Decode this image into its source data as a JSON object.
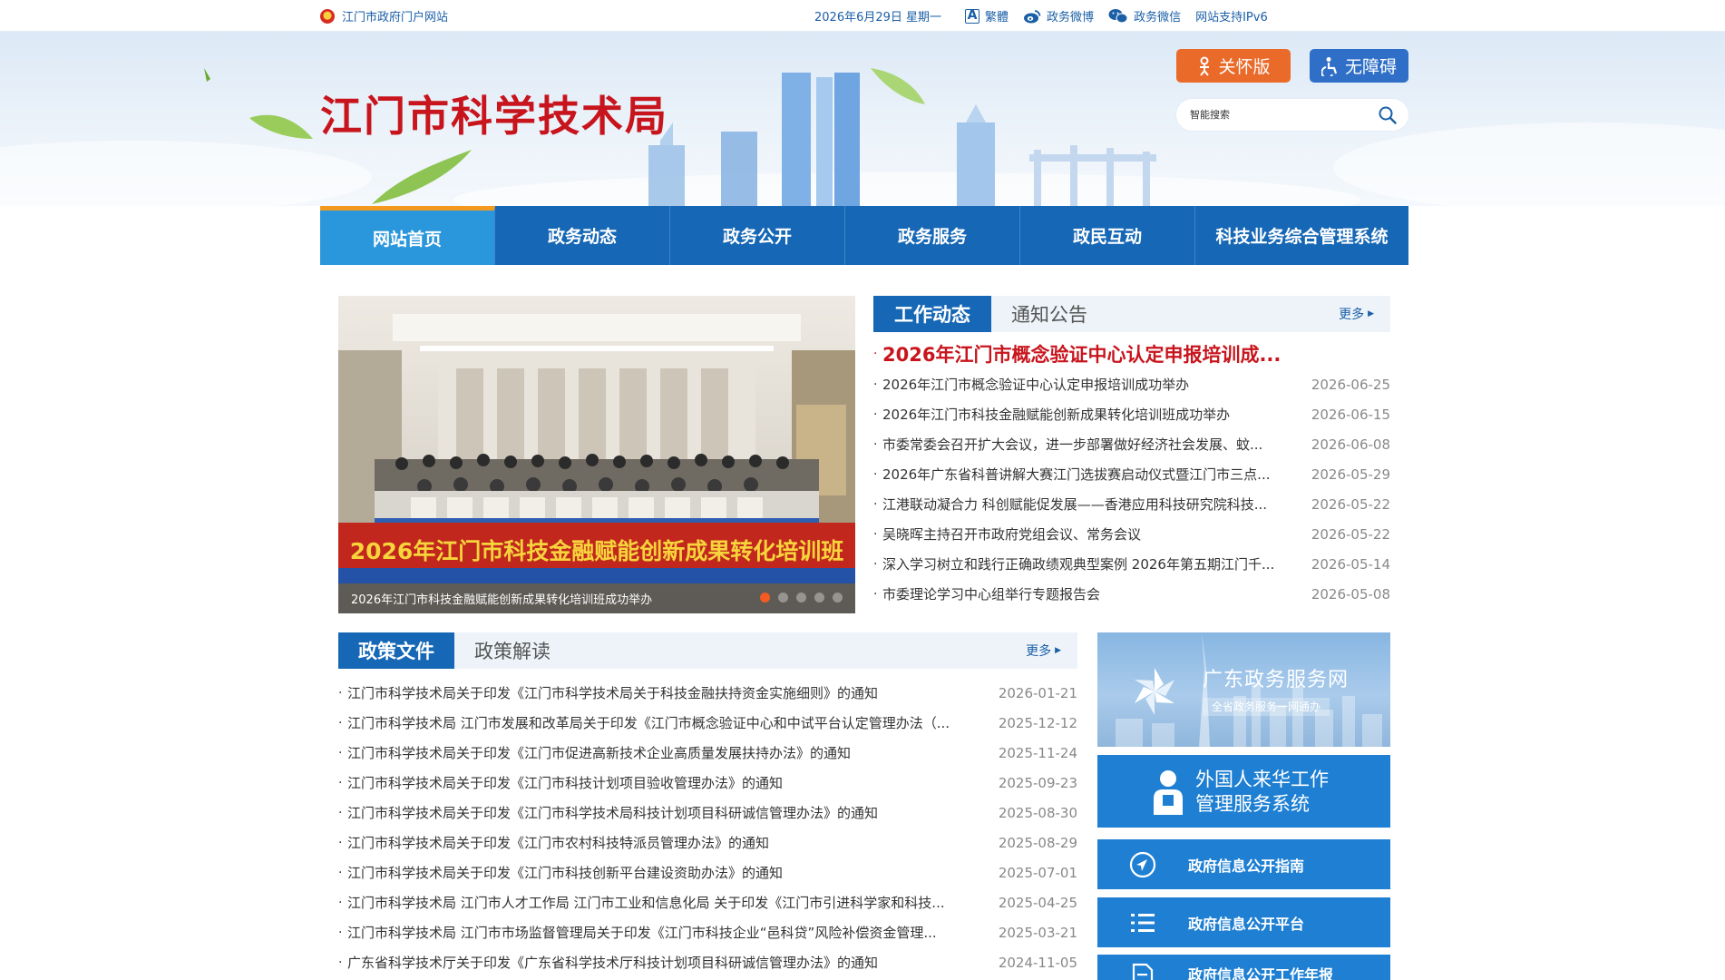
{
  "topbar": {
    "portal_label": "江门市政府门户网站",
    "date": "2026年6月29日 星期一",
    "links": [
      {
        "label": "繁體",
        "icon": "traditional-chinese-icon"
      },
      {
        "label": "政务微博",
        "icon": "weibo-icon"
      },
      {
        "label": "政务微信",
        "icon": "wechat-icon"
      },
      {
        "label": "网站支持IPv6",
        "icon": ""
      }
    ]
  },
  "header": {
    "site_title": "江门市科学技术局",
    "care_mode_label": "关怀版",
    "accessibility_label": "无障碍",
    "search_placeholder": "智能搜索"
  },
  "nav": {
    "items": [
      "网站首页",
      "政务动态",
      "政务公开",
      "政务服务",
      "政民互动",
      "科技业务综合管理系统"
    ],
    "active_index": 0
  },
  "carousel": {
    "caption": "2026年江门市科技金融赋能创新成果转化培训班成功举办",
    "banner_text": "2026年江门市科技金融赋能创新成果转化培训班",
    "slide_count": 5,
    "active_slide": 1
  },
  "work_news": {
    "tabs": [
      "工作动态",
      "通知公告"
    ],
    "more_label": "更多",
    "headline": "2026年江门市概念验证中心认定申报培训成...",
    "items": [
      {
        "title": "2026年江门市概念验证中心认定申报培训成功举办",
        "date": "2026-06-25"
      },
      {
        "title": "2026年江门市科技金融赋能创新成果转化培训班成功举办",
        "date": "2026-06-15"
      },
      {
        "title": "市委常委会召开扩大会议，进一步部署做好经济社会发展、蚊...",
        "date": "2026-06-08"
      },
      {
        "title": "2026年广东省科普讲解大赛江门选拔赛启动仪式暨江门市三点...",
        "date": "2026-05-29"
      },
      {
        "title": "江港联动凝合力 科创赋能促发展——香港应用科技研究院科技...",
        "date": "2026-05-22"
      },
      {
        "title": "吴晓晖主持召开市政府党组会议、常务会议",
        "date": "2026-05-22"
      },
      {
        "title": "深入学习树立和践行正确政绩观典型案例 2026年第五期江门千...",
        "date": "2026-05-14"
      },
      {
        "title": "市委理论学习中心组举行专题报告会",
        "date": "2026-05-08"
      }
    ]
  },
  "policy": {
    "tabs": [
      "政策文件",
      "政策解读"
    ],
    "more_label": "更多",
    "items": [
      {
        "title": "江门市科学技术局关于印发《江门市科学技术局关于科技金融扶持资金实施细则》的通知",
        "date": "2026-01-21"
      },
      {
        "title": "江门市科学技术局 江门市发展和改革局关于印发《江门市概念验证中心和中试平台认定管理办法（...",
        "date": "2025-12-12"
      },
      {
        "title": "江门市科学技术局关于印发《江门市促进高新技术企业高质量发展扶持办法》的通知",
        "date": "2025-11-24"
      },
      {
        "title": "江门市科学技术局关于印发《江门市科技计划项目验收管理办法》的通知",
        "date": "2025-09-23"
      },
      {
        "title": "江门市科学技术局关于印发《江门市科学技术局科技计划项目科研诚信管理办法》的通知",
        "date": "2025-08-30"
      },
      {
        "title": "江门市科学技术局关于印发《江门市农村科技特派员管理办法》的通知",
        "date": "2025-08-29"
      },
      {
        "title": "江门市科学技术局关于印发《江门市科技创新平台建设资助办法》的通知",
        "date": "2025-07-01"
      },
      {
        "title": "江门市科学技术局 江门市人才工作局 江门市工业和信息化局 关于印发《江门市引进科学家和科技...",
        "date": "2025-04-25"
      },
      {
        "title": "江门市科学技术局 江门市市场监督管理局关于印发《江门市科技企业“邑科贷”风险补偿资金管理...",
        "date": "2025-03-21"
      },
      {
        "title": "广东省科学技术厅关于印发《广东省科学技术厅科技计划项目科研诚信管理办法》的通知",
        "date": "2024-11-05"
      }
    ]
  },
  "services": {
    "gd_title": "广东政务服务网",
    "gd_subtitle": "全省政务服务一网通办",
    "foreign_line1": "外国人来华工作",
    "foreign_line2": "管理服务系统",
    "guide_label": "政府信息公开指南",
    "platform_label": "政府信息公开平台",
    "report_label": "政府信息公开工作年报"
  },
  "colors": {
    "brand_blue": "#1667b5",
    "active_nav": "#2a96dc",
    "title_red": "#c8151d",
    "care_orange": "#ea6a2a",
    "service_blue": "#1e7fd3"
  }
}
